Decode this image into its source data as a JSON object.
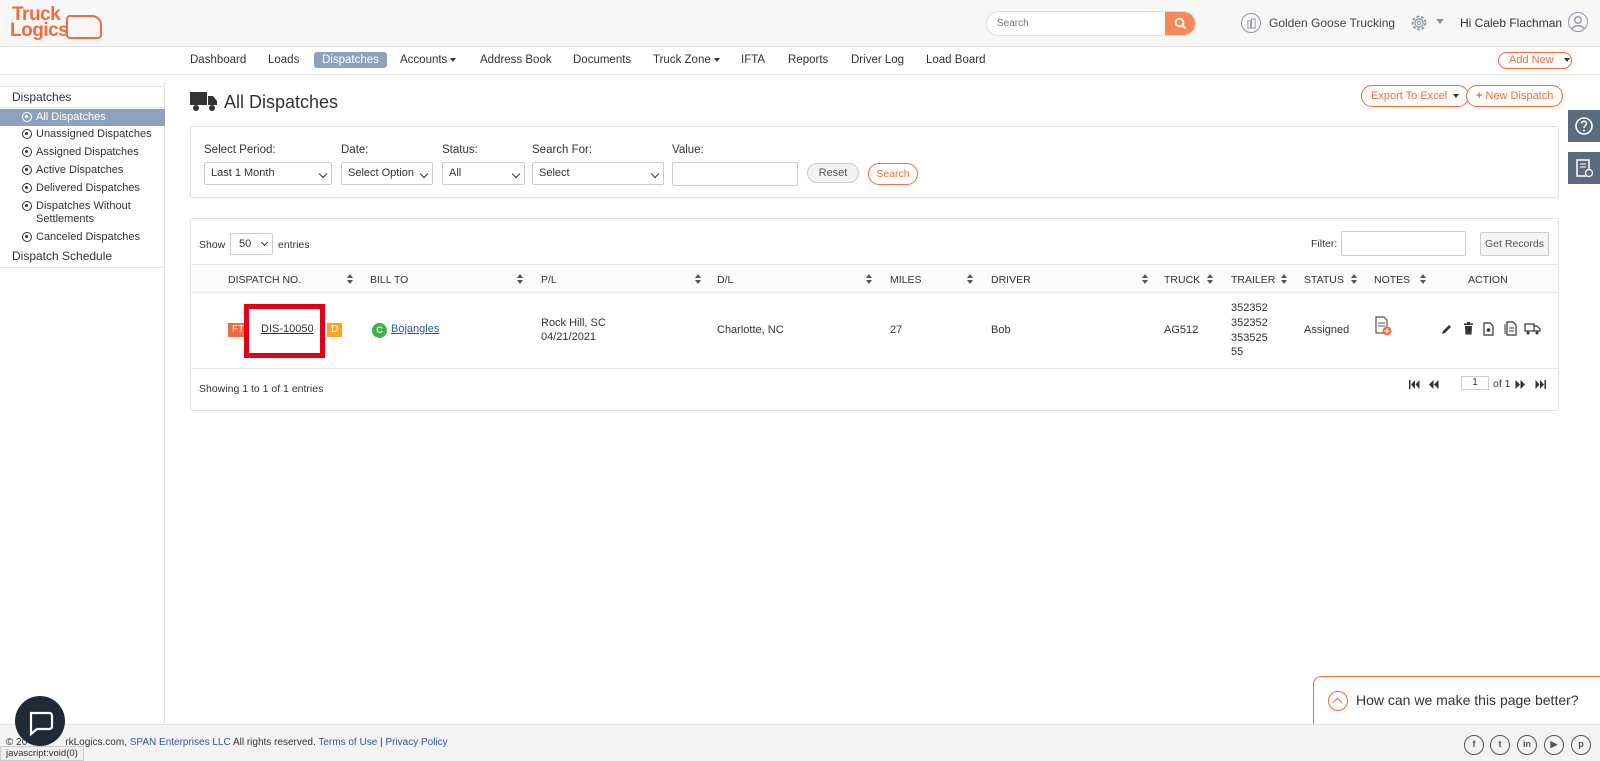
{
  "header": {
    "logo_line1": "Truck",
    "logo_line2": "Logics",
    "search_placeholder": "Search",
    "company": "Golden Goose Trucking",
    "greeting": "Hi Caleb Flachman"
  },
  "nav": {
    "items": [
      "Dashboard",
      "Loads",
      "Dispatches",
      "Accounts",
      "Address Book",
      "Documents",
      "Truck Zone",
      "IFTA",
      "Reports",
      "Driver Log",
      "Load Board"
    ],
    "active": "Dispatches",
    "add_new": "Add New"
  },
  "sidebar": {
    "section": "Dispatches",
    "items": [
      "All Dispatches",
      "Unassigned Dispatches",
      "Assigned Dispatches",
      "Active Dispatches",
      "Delivered Dispatches",
      "Dispatches Without Settlements",
      "Canceled Dispatches"
    ],
    "active": "All Dispatches",
    "schedule": "Dispatch Schedule"
  },
  "page": {
    "title": "All Dispatches",
    "export_btn": "Export To Excel",
    "new_btn": "New Dispatch"
  },
  "filters": {
    "period_label": "Select Period:",
    "period_value": "Last 1 Month",
    "date_label": "Date:",
    "date_value": "Select Option",
    "status_label": "Status:",
    "status_value": "All",
    "search_for_label": "Search For:",
    "search_for_value": "Select",
    "value_label": "Value:",
    "reset": "Reset",
    "search": "Search"
  },
  "table": {
    "show_label": "Show",
    "show_value": "50",
    "entries_label": "entries",
    "filter_label": "Filter:",
    "get_records": "Get Records",
    "columns": [
      "DISPATCH NO.",
      "BILL TO",
      "P/L",
      "D/L",
      "MILES",
      "DRIVER",
      "TRUCK",
      "TRAILER",
      "STATUS",
      "NOTES",
      "ACTION"
    ],
    "rows": [
      {
        "badge_left": "FT",
        "badge_right": "D",
        "dispatch_no": "DIS-10050",
        "bill_to_icon": "C",
        "bill_to": "Bojangles",
        "pl_city": "Rock Hill, SC",
        "pl_date": "04/21/2021",
        "dl": "Charlotte, NC",
        "miles": "27",
        "driver": "Bob",
        "truck": "AG512",
        "trailer": [
          "352352",
          "352352",
          "353525",
          "55"
        ],
        "status": "Assigned"
      }
    ],
    "showing": "Showing 1 to 1 of 1 entries",
    "page_current": "1",
    "page_of": "of 1"
  },
  "feedback": "How can we make this page better?",
  "footer": {
    "copyright_start": "© 20",
    "copyright_mid": "rkLogics.com,",
    "company_link": "SPAN Enterprises LLC",
    "rights": "All rights reserved.",
    "terms": "Terms of Use",
    "privacy": "Privacy Policy",
    "status_url": "javascript:void(0)"
  },
  "colors": {
    "accent": "#f26b3a",
    "nav_active": "#8fa2bd",
    "highlight": "#e3001b",
    "badge_ft": "#f26b3a",
    "badge_d": "#f5a623",
    "c_icon": "#37b34a"
  }
}
